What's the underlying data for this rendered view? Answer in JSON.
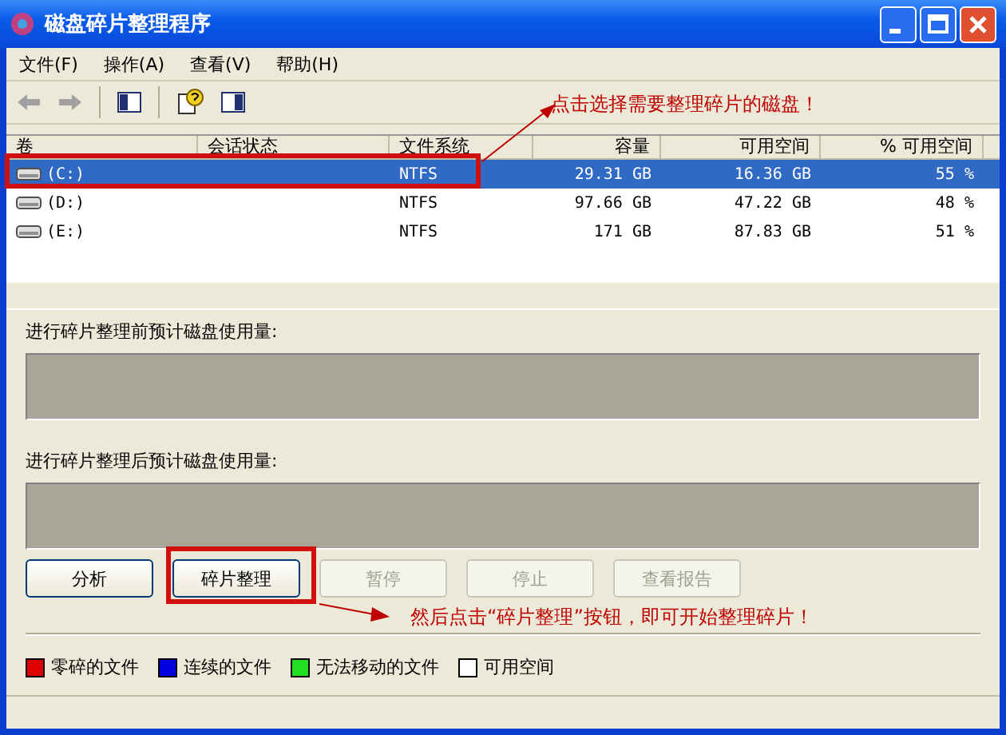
{
  "window": {
    "title": "磁盘碎片整理程序"
  },
  "menu": [
    "文件(F)",
    "操作(A)",
    "查看(V)",
    "帮助(H)"
  ],
  "volumes": {
    "columns": [
      "卷",
      "会话状态",
      "文件系统",
      "容量",
      "可用空间",
      "% 可用空间"
    ],
    "rows": [
      {
        "cells": [
          "(C:)",
          "",
          "NTFS",
          "29.31 GB",
          "16.36 GB",
          "55 %"
        ],
        "selected": true
      },
      {
        "cells": [
          "(D:)",
          "",
          "NTFS",
          "97.66 GB",
          "47.22 GB",
          "48 %"
        ],
        "selected": false
      },
      {
        "cells": [
          "(E:)",
          "",
          "NTFS",
          "171 GB",
          "87.83 GB",
          "51 %"
        ],
        "selected": false
      }
    ]
  },
  "before_label": "进行碎片整理前预计磁盘使用量:",
  "after_label": "进行碎片整理后预计磁盘使用量:",
  "buttons": [
    {
      "label": "分析",
      "disabled": false
    },
    {
      "label": "碎片整理",
      "disabled": false
    },
    {
      "label": "暂停",
      "disabled": true
    },
    {
      "label": "停止",
      "disabled": true
    },
    {
      "label": "查看报告",
      "disabled": true
    }
  ],
  "legend": [
    {
      "label": "零碎的文件",
      "color": "#e00000"
    },
    {
      "label": "连续的文件",
      "color": "#0000e0"
    },
    {
      "label": "无法移动的文件",
      "color": "#20e020"
    },
    {
      "label": "可用空间",
      "color": "#ffffff"
    }
  ],
  "annotations": [
    {
      "text": "点击选择需要整理碎片的磁盘！"
    },
    {
      "text": "然后点击“碎片整理”按钮，即可开始整理碎片！"
    }
  ]
}
